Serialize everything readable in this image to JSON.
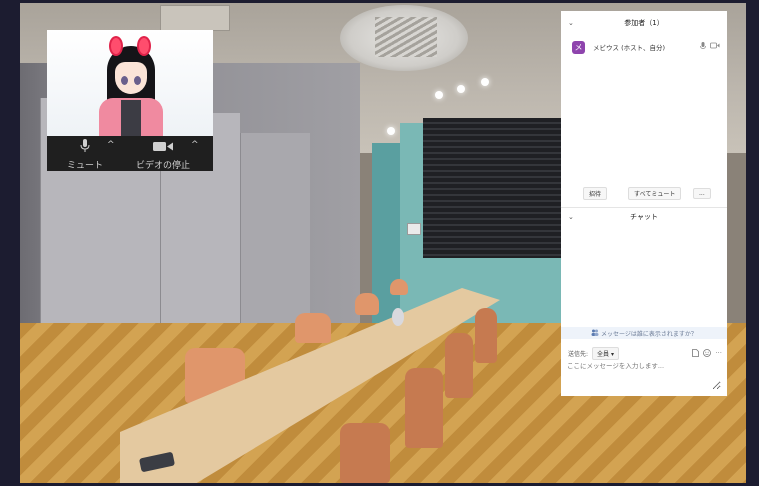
{
  "video_tile": {
    "mute_label": "ミュート",
    "video_label": "ビデオの停止",
    "mute_caret": "^",
    "video_caret": "^"
  },
  "participants_panel": {
    "collapse_glyph": "⌄",
    "title": "参加者（1）",
    "participants": [
      {
        "initial": "メ",
        "name": "メビウス (ホスト、自分)",
        "badge_color": "#8e44ad"
      }
    ],
    "invite_label": "招待",
    "mute_all_label": "すべてミュート",
    "more_label": "..."
  },
  "chat_panel": {
    "collapse_glyph": "⌄",
    "title": "チャット",
    "privacy_notice": "メッセージは誰に表示されますか？",
    "send_to_label": "送信先:",
    "recipient": "全員",
    "input_placeholder": "ここにメッセージを入力します...",
    "more_glyph": "···"
  },
  "icons": [
    "microphone-icon",
    "video-camera-icon",
    "file-icon",
    "emoji-icon",
    "people-icon"
  ]
}
